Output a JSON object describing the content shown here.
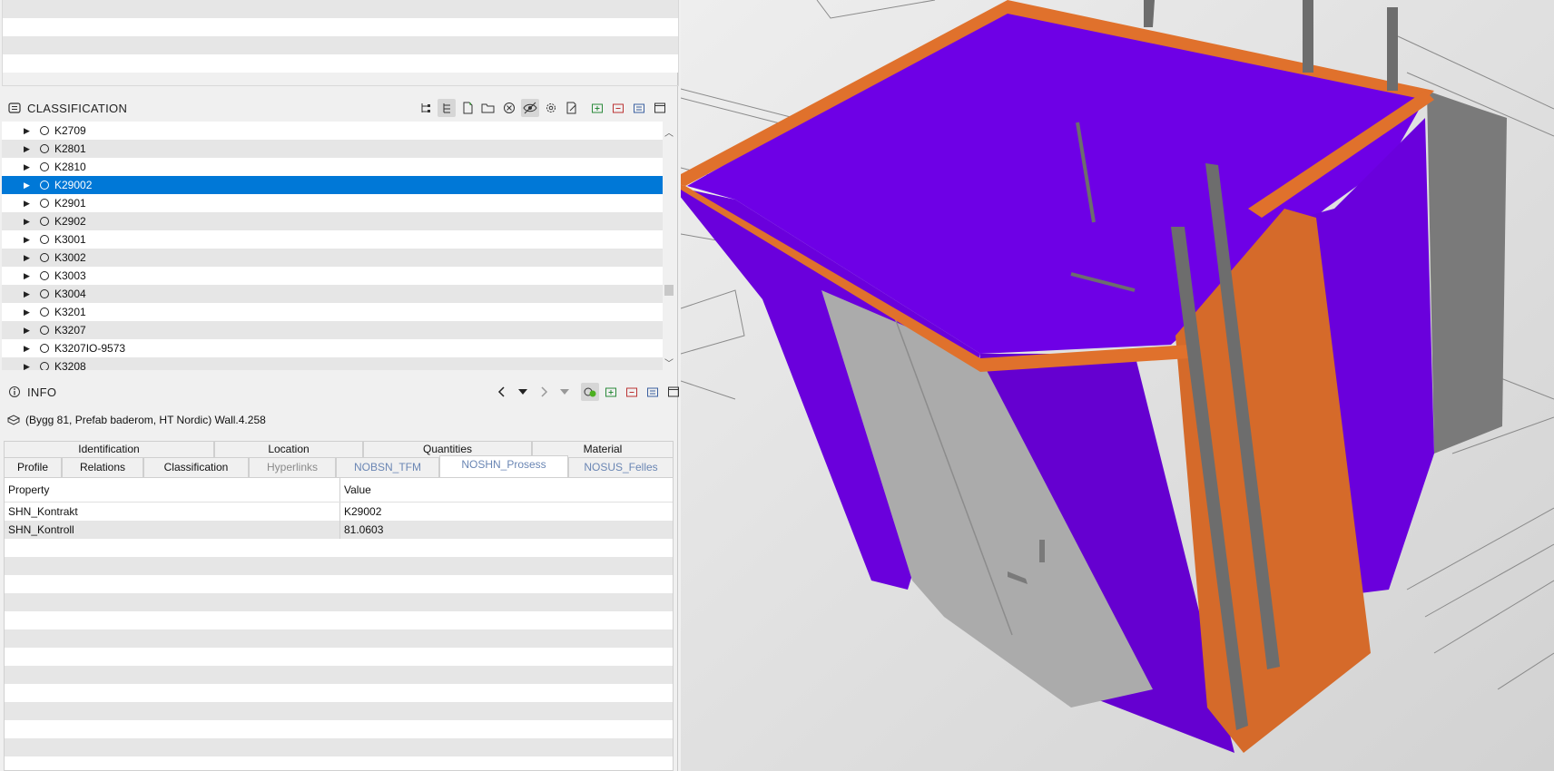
{
  "classification": {
    "title": "CLASSIFICATION",
    "items": [
      {
        "label": "K2709"
      },
      {
        "label": "K2801"
      },
      {
        "label": "K2810"
      },
      {
        "label": "K29002"
      },
      {
        "label": "K2901"
      },
      {
        "label": "K2902"
      },
      {
        "label": "K3001"
      },
      {
        "label": "K3002"
      },
      {
        "label": "K3003"
      },
      {
        "label": "K3004"
      },
      {
        "label": "K3201"
      },
      {
        "label": "K3207"
      },
      {
        "label": "K3207IO-9573"
      },
      {
        "label": "K3208"
      }
    ],
    "selected_label": "K29002",
    "toolbar_icons": [
      "tree-structure-icon",
      "tree-list-icon",
      "new-document-icon",
      "open-folder-icon",
      "close-circle-icon",
      "visibility-icon",
      "settings-gear-icon",
      "edit-document-icon",
      "add-panel-icon",
      "remove-panel-icon",
      "panel-icon",
      "window-icon"
    ]
  },
  "info": {
    "title": "INFO",
    "object_name": "(Bygg 81, Prefab baderom, HT Nordic) Wall.4.258",
    "tabs_row1": [
      "Identification",
      "Location",
      "Quantities",
      "Material"
    ],
    "tabs_row2": [
      "Profile",
      "Relations",
      "Classification",
      "Hyperlinks",
      "NOBSN_TFM",
      "NOSHN_Prosess",
      "NOSUS_Felles"
    ],
    "active_tab": "NOSHN_Prosess",
    "table": {
      "headers": [
        "Property",
        "Value"
      ],
      "rows": [
        {
          "property": "SHN_Kontrakt",
          "value": "K29002"
        },
        {
          "property": "SHN_Kontroll",
          "value": "81.0603"
        }
      ]
    }
  },
  "colors": {
    "selection": "#0078d7",
    "wall_purple": "#6e00e6",
    "wall_orange": "#e0712c",
    "door_gray": "#ababab"
  }
}
